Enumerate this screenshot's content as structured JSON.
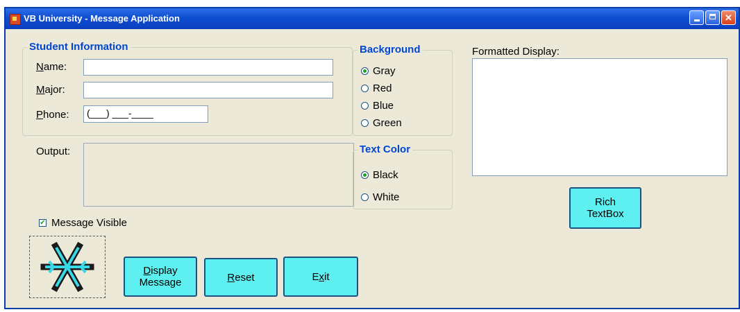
{
  "window": {
    "title": "VB University - Message Application"
  },
  "student": {
    "group_title": "Student Information",
    "name_label": "Name:",
    "name_value": "",
    "major_label": "Major:",
    "major_value": "",
    "phone_label": "Phone:",
    "phone_value": "(___) ___-____"
  },
  "output": {
    "label": "Output:",
    "value": ""
  },
  "message_visible": {
    "label": "Message Visible",
    "checked": true
  },
  "background": {
    "title": "Background",
    "options": [
      "Gray",
      "Red",
      "Blue",
      "Green"
    ],
    "selected": "Gray"
  },
  "text_color": {
    "title": "Text Color",
    "options": [
      "Black",
      "White"
    ],
    "selected": "Black"
  },
  "formatted": {
    "label": "Formatted Display:",
    "value": ""
  },
  "buttons": {
    "rich_line1": "Rich",
    "rich_line2": "TextBox",
    "display_line1": "Display",
    "display_line2": "Message",
    "reset": "Reset",
    "exit": "Exit"
  },
  "icons": {
    "picture": "snowflake-icon"
  }
}
